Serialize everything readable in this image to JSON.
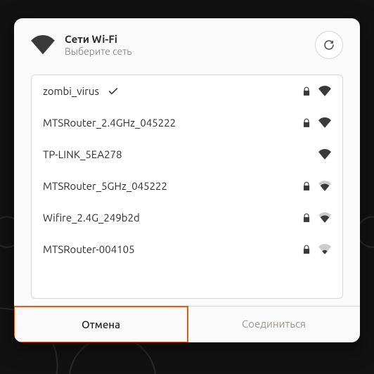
{
  "header": {
    "title": "Сети Wi-Fi",
    "subtitle": "Выберите сеть"
  },
  "networks": [
    {
      "ssid": "zombi_virus",
      "connected": true,
      "secured": true,
      "signal": 3
    },
    {
      "ssid": "MTSRouter_2.4GHz_045222",
      "connected": false,
      "secured": true,
      "signal": 3
    },
    {
      "ssid": "TP-LINK_5EA278",
      "connected": false,
      "secured": false,
      "signal": 3
    },
    {
      "ssid": "MTSRouter_5GHz_045222",
      "connected": false,
      "secured": true,
      "signal": 2
    },
    {
      "ssid": "Wifire_2.4G_249b2d",
      "connected": false,
      "secured": true,
      "signal": 2
    },
    {
      "ssid": "MTSRouter-004105",
      "connected": false,
      "secured": true,
      "signal": 1
    }
  ],
  "footer": {
    "cancel": "Отмена",
    "connect": "Соединиться"
  },
  "icons": {
    "wifi": "wifi-icon",
    "refresh": "refresh-icon",
    "check": "check-icon",
    "lock": "lock-icon",
    "signal": "wifi-signal-icon"
  }
}
